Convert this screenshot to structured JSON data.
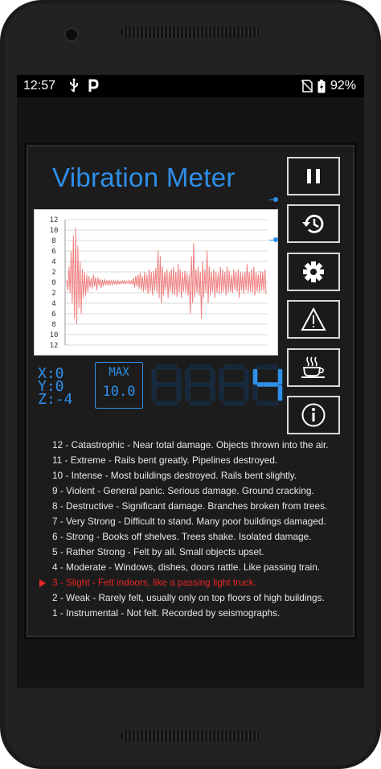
{
  "status": {
    "time": "12:57",
    "battery": "92%"
  },
  "app": {
    "title": "Vibration Meter",
    "graph": {
      "yticks": [
        "12",
        "10",
        "8",
        "6",
        "4",
        "2",
        "0",
        "2",
        "4",
        "6",
        "8",
        "10",
        "12"
      ],
      "x": [
        0,
        1,
        2,
        3,
        4,
        5,
        6,
        7,
        8,
        9,
        10,
        11,
        12,
        13,
        14,
        15,
        16,
        17,
        18,
        19,
        20,
        21,
        22,
        23,
        24,
        25,
        26,
        27,
        28,
        29,
        30,
        31,
        32,
        33,
        34,
        35,
        36,
        37,
        38,
        39,
        40,
        41,
        42,
        43,
        44,
        45,
        46,
        47,
        48,
        49,
        50,
        51,
        52,
        53,
        54,
        55,
        56,
        57,
        58,
        59,
        60,
        61,
        62,
        63,
        64,
        65,
        66,
        67,
        68,
        69,
        70,
        71,
        72,
        73,
        74,
        75,
        76,
        77,
        78,
        79,
        80,
        81,
        82,
        83,
        84,
        85,
        86,
        87,
        88,
        89,
        90,
        91,
        92,
        93,
        94,
        95,
        96,
        97,
        98,
        99,
        100,
        101,
        102,
        103,
        104,
        105,
        106,
        107,
        108,
        109,
        110,
        111,
        112,
        113,
        114,
        115,
        116,
        117,
        118,
        119,
        120,
        121,
        122,
        123,
        124,
        125,
        126,
        127,
        128,
        129,
        130,
        131,
        132,
        133,
        134,
        135,
        136,
        137,
        138,
        139,
        140,
        141,
        142,
        143,
        144,
        145,
        146,
        147,
        148,
        149,
        150,
        151,
        152,
        153,
        154,
        155,
        156,
        157,
        158,
        159,
        160,
        161,
        162,
        163,
        164,
        165,
        166,
        167,
        168,
        169,
        170,
        171,
        172,
        173,
        174,
        175,
        176,
        177,
        178,
        179
      ],
      "values": [
        0.5,
        -1.5,
        3,
        -2,
        6,
        -4,
        9,
        -7,
        10.5,
        -8,
        7,
        -5,
        4,
        -6,
        2.5,
        -3,
        2,
        -2.5,
        1.5,
        -1.8,
        1.2,
        -1,
        0.8,
        -1.2,
        1.5,
        -0.8,
        1,
        -1.5,
        0.9,
        -0.6,
        0.7,
        -1.1,
        0.5,
        -0.7,
        0.6,
        -0.5,
        0.4,
        -0.6,
        0.5,
        -0.4,
        0.3,
        -0.5,
        0.4,
        -0.3,
        0.3,
        -0.4,
        0.3,
        -0.3,
        0.2,
        -0.3,
        0.3,
        -0.2,
        0.3,
        -0.3,
        0.2,
        -0.2,
        0.4,
        -0.3,
        0.3,
        -0.4,
        0.8,
        -1,
        1.2,
        -0.8,
        1.5,
        -1.2,
        1.8,
        -1.5,
        1.2,
        -1.8,
        2,
        -1.5,
        1.5,
        -2.2,
        2.5,
        -1.8,
        2,
        -2.5,
        2.2,
        -1.5,
        2.8,
        -2,
        6,
        -3,
        5,
        -4,
        3,
        -2.5,
        2,
        -1.5,
        2.5,
        -3,
        2,
        -1.8,
        2.5,
        -2.2,
        3,
        -2.5,
        2,
        -2.8,
        3.5,
        -2,
        2.5,
        -3,
        2,
        -1.8,
        2.2,
        -2,
        1.8,
        -2.5,
        1.5,
        -6,
        5,
        -4,
        7.5,
        -3,
        2.5,
        -2,
        3,
        -2.5,
        2,
        -7,
        4,
        -3,
        2.5,
        -2,
        6,
        -4,
        3,
        -2.5,
        2,
        -1.8,
        2.5,
        -3,
        2,
        -2,
        1.8,
        -2.2,
        3,
        -2,
        2.5,
        -1.8,
        2,
        -2.5,
        3,
        -2,
        2.2,
        -1.8,
        1.5,
        -2,
        2.5,
        -1.5,
        2,
        -1.8,
        2.5,
        -3,
        2,
        -1.5,
        1.8,
        -2.2,
        2,
        -1.5,
        3.5,
        -2,
        2,
        -1.8,
        2.5,
        -2,
        3,
        -2.5,
        2,
        -1.8,
        1.5,
        -2,
        2.2,
        -1.5,
        2,
        -1.8,
        2.5,
        -2.2,
        2,
        -1.5,
        1.8,
        -2
      ],
      "ylim": [
        -12,
        12
      ]
    },
    "xyz": {
      "x": "X:0",
      "y": "Y:0",
      "z": "Z:-4"
    },
    "max": {
      "label": "MAX",
      "value": "10.0"
    },
    "display": {
      "digits": [
        "8",
        "8",
        "8",
        "4"
      ],
      "active_index": 3
    },
    "colors": {
      "accent": "#2f8fe8",
      "active": "#e82626",
      "wave": "#f08080"
    },
    "buttons": [
      "pause-icon",
      "history-icon",
      "settings-gear-icon",
      "warning-icon",
      "coffee-cup-icon",
      "info-icon"
    ],
    "scale": [
      "12 - Catastrophic - Near total damage. Objects thrown into the air.",
      "11 - Extreme - Rails bent greatly. Pipelines destroyed.",
      "10 - Intense - Most buildings destroyed. Rails bent slightly.",
      "9 - Violent - General panic. Serious damage. Ground cracking.",
      "8 - Destructive - Significant damage. Branches broken from trees.",
      "7 - Very Strong - Difficult to stand. Many poor buildings damaged.",
      "6 - Strong - Books off shelves. Trees shake. Isolated damage.",
      "5 - Rather Strong - Felt by all. Small objects upset.",
      "4 - Moderate - Windows, dishes, doors rattle. Like passing train.",
      "3 - Slight - Felt indoors, like a passing light truck.",
      "2 - Weak - Rarely felt, usually only on top floors of high buildings.",
      "1 - Instrumental - Not felt. Recorded by seismographs."
    ],
    "active_scale_index": 9
  }
}
